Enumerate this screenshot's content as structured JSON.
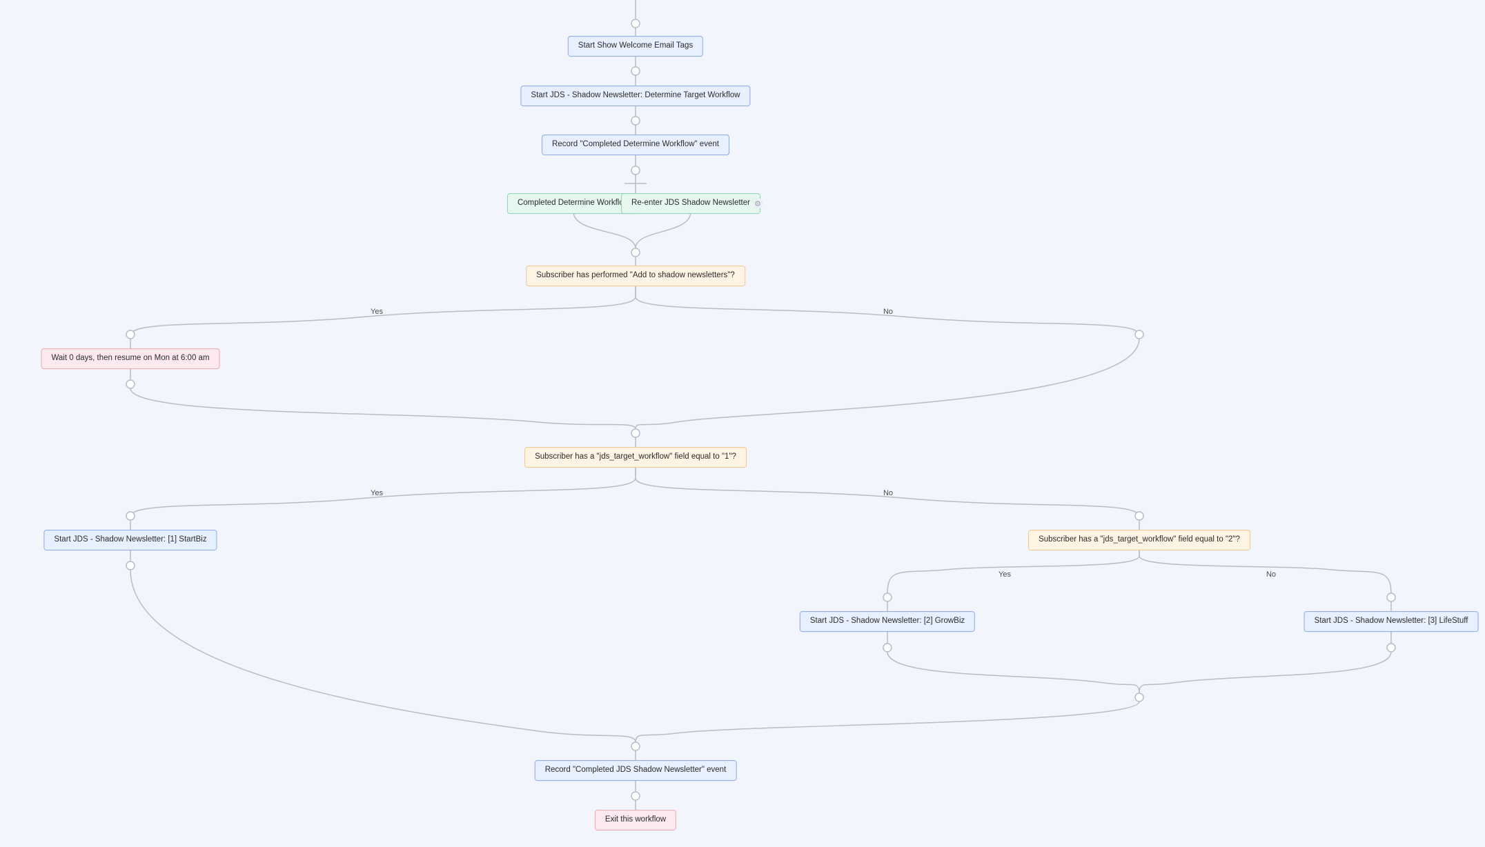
{
  "nodes": {
    "n1": {
      "label": "Start Show Welcome Email Tags"
    },
    "n2": {
      "label": "Start JDS - Shadow Newsletter: Determine Target Workflow"
    },
    "n3": {
      "label": "Record \"Completed Determine Workflow\" event"
    },
    "n4": {
      "label": "Completed Determine Workflow"
    },
    "n5": {
      "label": "Re-enter JDS Shadow Newsletter"
    },
    "n6": {
      "label": "Subscriber has performed \"Add to shadow newsletters\"?"
    },
    "n7": {
      "label": "Wait 0 days, then resume on Mon at 6:00 am"
    },
    "n8": {
      "label": "Subscriber has a \"jds_target_workflow\" field equal to \"1\"?"
    },
    "n9": {
      "label": "Start JDS - Shadow Newsletter: [1] StartBiz"
    },
    "n10": {
      "label": "Subscriber has a \"jds_target_workflow\" field equal to \"2\"?"
    },
    "n11": {
      "label": "Start JDS - Shadow Newsletter: [2] GrowBiz"
    },
    "n12": {
      "label": "Start JDS - Shadow Newsletter: [3] LifeStuff"
    },
    "n13": {
      "label": "Record \"Completed JDS Shadow Newsletter\" event"
    },
    "n14": {
      "label": "Exit this workflow"
    }
  },
  "labels": {
    "yes1": "Yes",
    "no1": "No",
    "yes2": "Yes",
    "no2": "No",
    "yes3": "Yes",
    "no3": "No"
  },
  "colors": {
    "blue_bg": "#e7f0ff",
    "blue_border": "#8aa7e6",
    "green_bg": "#e6f7ef",
    "green_border": "#8dd4b3",
    "orange_bg": "#fff3e3",
    "orange_border": "#f2c58a",
    "red_bg": "#fdeaee",
    "red_border": "#f0a3ae",
    "line": "#b5bdc8"
  }
}
